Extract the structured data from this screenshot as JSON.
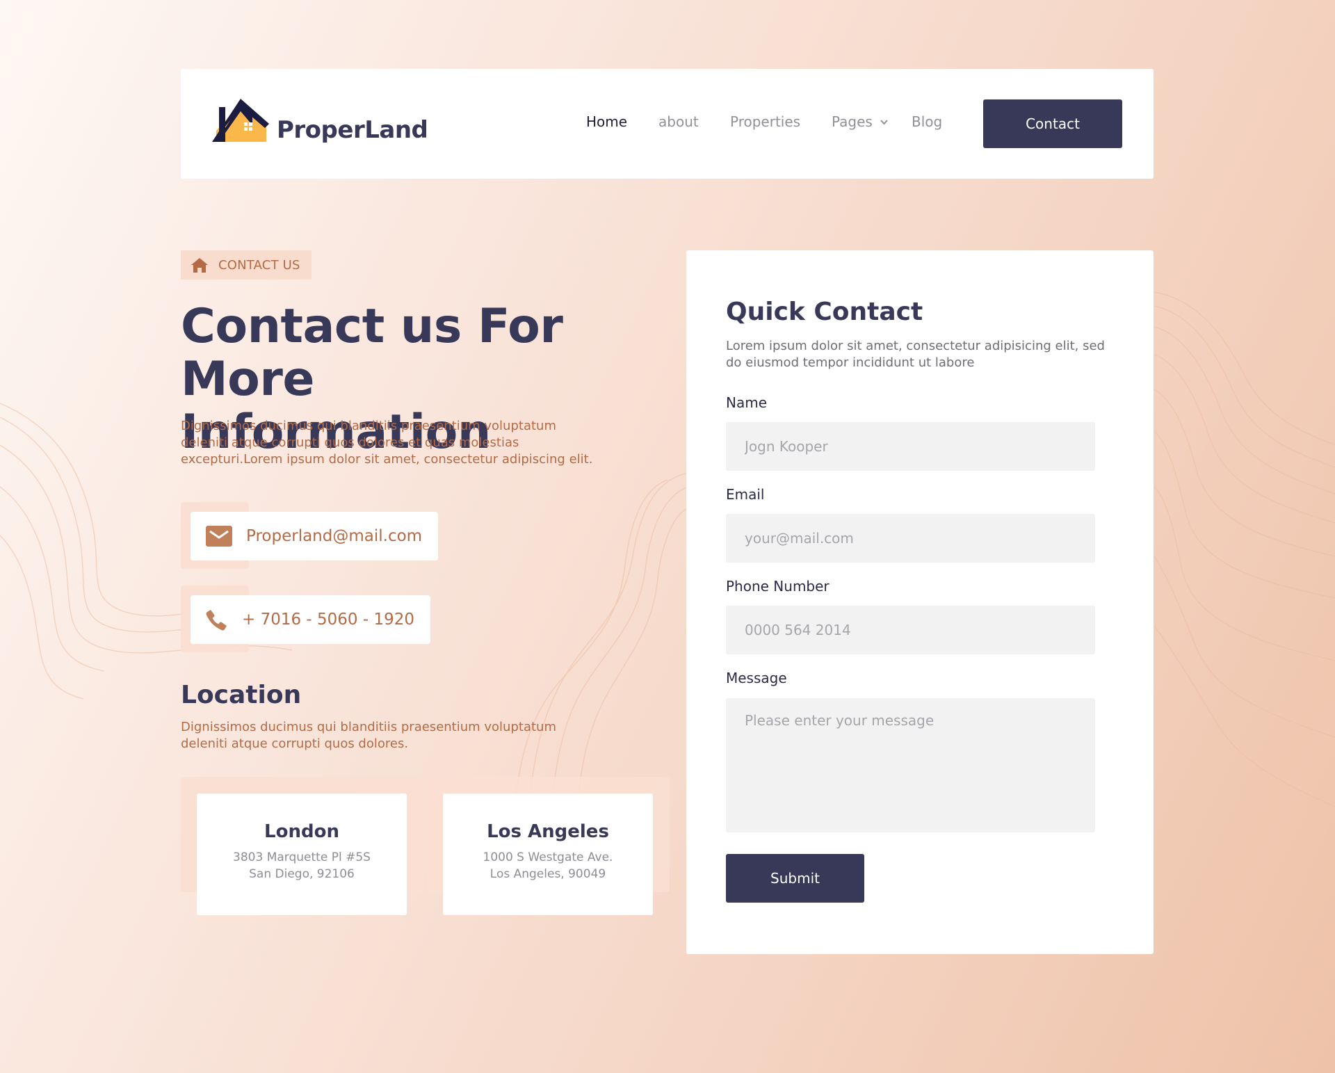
{
  "brand": {
    "name": "ProperLand",
    "colors": {
      "primary": "#383858",
      "accent": "#b36a45",
      "logo_roof": "#1c1c40",
      "logo_house": "#fbb84a"
    }
  },
  "nav": {
    "items": [
      {
        "label": "Home",
        "active": true
      },
      {
        "label": "about",
        "active": false
      },
      {
        "label": "Properties",
        "active": false
      },
      {
        "label": "Pages",
        "active": false,
        "has_dropdown": true
      },
      {
        "label": "Blog",
        "active": false
      }
    ],
    "cta_label": "Contact"
  },
  "hero": {
    "badge_icon": "home-icon",
    "badge_text": "CONTACT US",
    "title_line1": "Contact us For More",
    "title_line2": "Information",
    "description": "Dignissimos ducimus qui blanditiis praesentium voluptatum deleniti atque corrupti quos dolores et quas molestias excepturi.Lorem ipsum dolor sit amet, consectetur adipiscing elit."
  },
  "contacts": {
    "email": {
      "icon": "mail-icon",
      "value": "Properland@mail.com"
    },
    "phone": {
      "icon": "phone-icon",
      "value": "+ 7016 - 5060 - 1920"
    }
  },
  "location": {
    "title": "Location",
    "description": "Dignissimos ducimus qui blanditiis praesentium voluptatum deleniti atque corrupti quos dolores.",
    "cards": [
      {
        "city": "London",
        "line1": "3803 Marquette Pl #5S",
        "line2": "San Diego, 92106"
      },
      {
        "city": "Los Angeles",
        "line1": "1000 S Westgate Ave.",
        "line2": "Los Angeles, 90049"
      }
    ]
  },
  "form": {
    "title": "Quick Contact",
    "description": "Lorem ipsum dolor sit amet, consectetur adipisicing elit, sed do eiusmod tempor incididunt ut labore",
    "fields": {
      "name": {
        "label": "Name",
        "placeholder": "Jogn Kooper",
        "value": ""
      },
      "email": {
        "label": "Email",
        "placeholder": "your@mail.com",
        "value": ""
      },
      "phone": {
        "label": "Phone Number",
        "placeholder": "0000 564 2014",
        "value": ""
      },
      "message": {
        "label": "Message",
        "placeholder": "Please enter your message",
        "value": ""
      }
    },
    "submit_label": "Submit"
  }
}
